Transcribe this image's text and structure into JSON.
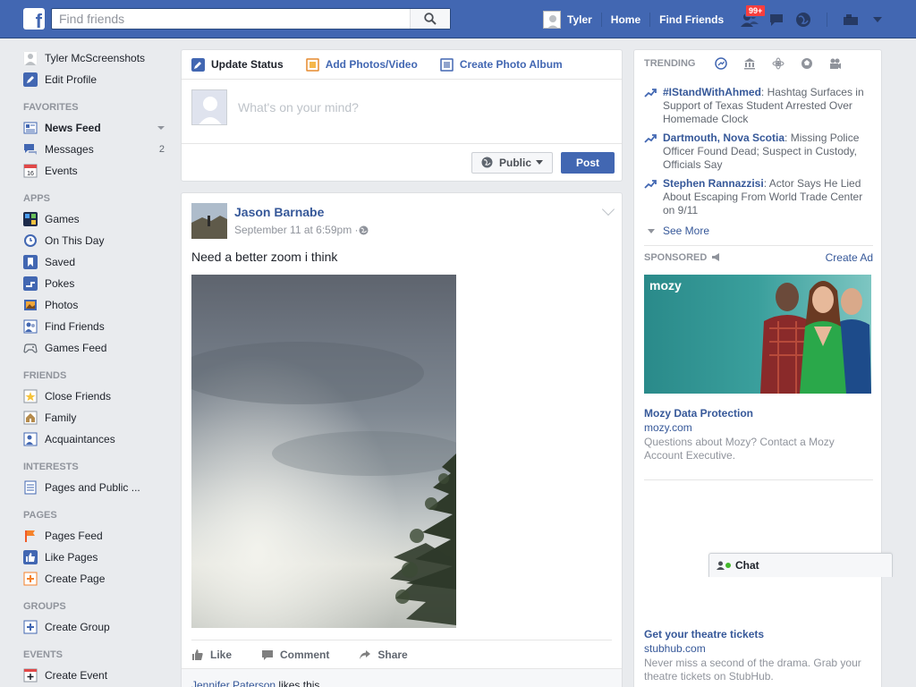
{
  "topbar": {
    "search_placeholder": "Find friends",
    "user_name": "Tyler",
    "home": "Home",
    "find_friends": "Find Friends",
    "notifications_badge": "99+"
  },
  "sidebar": {
    "profile_name": "Tyler McScreenshots",
    "edit_profile": "Edit Profile",
    "favorites_head": "FAVORITES",
    "news_feed": "News Feed",
    "messages": "Messages",
    "messages_count": "2",
    "events": "Events",
    "apps_head": "APPS",
    "games": "Games",
    "on_this_day": "On This Day",
    "saved": "Saved",
    "pokes": "Pokes",
    "photos": "Photos",
    "find_friends": "Find Friends",
    "games_feed": "Games Feed",
    "friends_head": "FRIENDS",
    "close_friends": "Close Friends",
    "family": "Family",
    "acquaintances": "Acquaintances",
    "interests_head": "INTERESTS",
    "pages_public": "Pages and Public ...",
    "pages_head": "PAGES",
    "pages_feed": "Pages Feed",
    "like_pages": "Like Pages",
    "create_page": "Create Page",
    "groups_head": "GROUPS",
    "create_group": "Create Group",
    "events_head": "EVENTS",
    "create_event": "Create Event"
  },
  "composer": {
    "tab_status": "Update Status",
    "tab_photos": "Add Photos/Video",
    "tab_album": "Create Photo Album",
    "placeholder": "What's on your mind?",
    "privacy": "Public",
    "post": "Post"
  },
  "post": {
    "author": "Jason Barnabe",
    "time": "September 11 at 6:59pm · ",
    "text": "Need a better zoom i think",
    "like": "Like",
    "comment": "Comment",
    "share": "Share",
    "liker": "Jennifer Paterson",
    "likes_suffix": " likes this."
  },
  "trending": {
    "title": "TRENDING",
    "items": [
      {
        "topic": "#IStandWithAhmed",
        "desc": ": Hashtag Surfaces in Support of Texas Student Arrested Over Homemade Clock"
      },
      {
        "topic": "Dartmouth, Nova Scotia",
        "desc": ": Missing Police Officer Found Dead; Suspect in Custody, Officials Say"
      },
      {
        "topic": "Stephen Rannazzisi",
        "desc": ": Actor Says He Lied About Escaping From World Trade Center on 9/11"
      }
    ],
    "see_more": "See More"
  },
  "sponsored": {
    "title": "SPONSORED",
    "create_ad": "Create Ad",
    "ad1": {
      "logo": "mozy",
      "title": "Mozy Data Protection",
      "domain": "mozy.com",
      "desc": "Questions about Mozy? Contact a Mozy Account Executive."
    },
    "ad2": {
      "title": "Get your theatre tickets",
      "domain": "stubhub.com",
      "desc": "Never miss a second of the drama. Grab your theatre tickets on StubHub."
    }
  },
  "chat": {
    "label": "Chat"
  }
}
